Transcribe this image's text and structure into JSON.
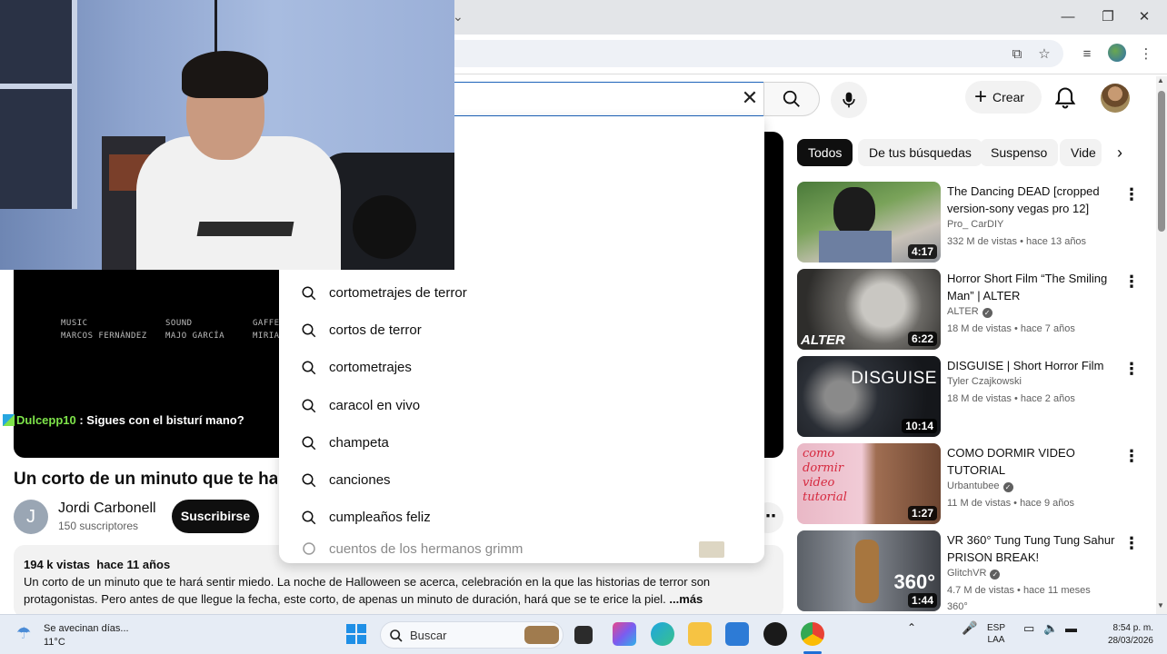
{
  "colors": {
    "accent_blue": "#1c62b9",
    "chip_active": "#0f0f0f",
    "chat_user": "#7ee34a"
  },
  "header": {
    "create_label": "Crear"
  },
  "search": {
    "suggestions": [
      "cortometrajes de terror",
      "cortos de terror",
      "cortometrajes",
      "caracol en vivo",
      "champeta",
      "canciones",
      "cumpleaños feliz",
      "cuentos de los hermanos grimm"
    ]
  },
  "player": {
    "credits": [
      {
        "role": "MUSIC",
        "name": "MARCOS FERNÁNDEZ"
      },
      {
        "role": "SOUND",
        "name": "MAJO GARCÍA"
      },
      {
        "role": "GAFFER",
        "name": "MIRIA"
      }
    ]
  },
  "chat": {
    "user": "Dulcepp10",
    "message": " : Sigues con el bisturí mano?"
  },
  "video": {
    "title": "Un corto de un minuto que te hará sentir miedo",
    "channel": "Jordi Carbonell",
    "channel_initial": "J",
    "subscribers": "150 suscriptores",
    "subscribe_label": "Suscribirse",
    "views": "194 k vistas",
    "age": "hace 11 años",
    "description": "Un corto de un minuto que te hará sentir miedo. La noche de Halloween se acerca, celebración en la que las historias de terror son protagonistas. Pero antes de que llegue la fecha, este corto, de apenas un minuto de duración, hará que se te erice la piel. ",
    "more_label": "...más"
  },
  "chips": [
    "Todos",
    "De tus búsquedas",
    "Suspenso",
    "Vide"
  ],
  "recommendations": [
    {
      "title": "The Dancing DEAD [cropped version-sony vegas pro 12]",
      "channel": "Pro_ CarDIY",
      "verified": false,
      "meta": "332 M de vistas • hace 13 años",
      "duration": "4:17"
    },
    {
      "title": "Horror Short Film “The Smiling Man” | ALTER",
      "channel": "ALTER",
      "verified": true,
      "meta": "18 M de vistas • hace 7 años",
      "duration": "6:22",
      "thumb_text": "ALTER"
    },
    {
      "title": "DISGUISE | Short Horror Film",
      "channel": "Tyler Czajkowski",
      "verified": false,
      "meta": "18 M de vistas • hace 2 años",
      "duration": "10:14",
      "thumb_text": "DISGUISE"
    },
    {
      "title": "COMO DORMIR VIDEO TUTORIAL",
      "channel": "Urbantubee",
      "verified": true,
      "meta": "11 M de vistas • hace 9 años",
      "duration": "1:27",
      "thumb_text": "como dormir video tutorial"
    },
    {
      "title": "VR 360° Tung Tung Tung Sahur PRISON BREAK!",
      "channel": "GlitchVR",
      "verified": true,
      "meta": "4.7 M de vistas • hace 11 meses",
      "duration": "1:44",
      "extra": "360°",
      "thumb_text": "360°"
    }
  ],
  "taskbar": {
    "weather_title": "Se avecinan días...",
    "weather_temp": "11°C",
    "search_label": "Buscar",
    "lang_1": "ESP",
    "lang_2": "LAA",
    "time": "8:54 p. m.",
    "date": "28/03/2026"
  }
}
